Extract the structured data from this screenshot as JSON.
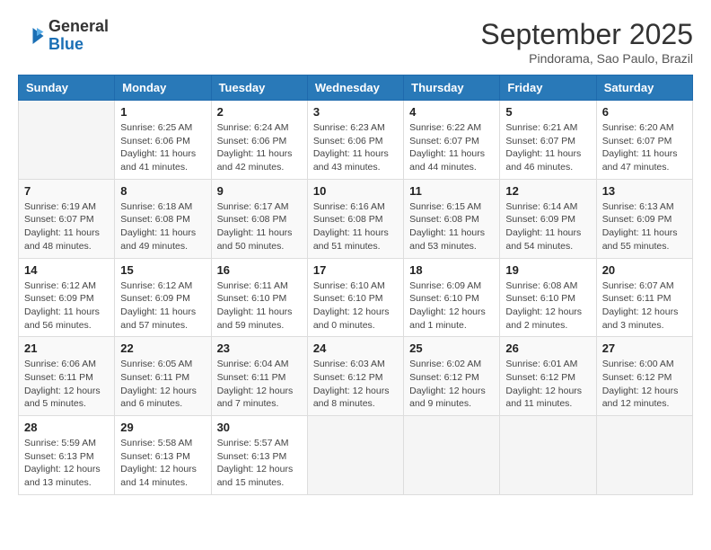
{
  "header": {
    "logo_general": "General",
    "logo_blue": "Blue",
    "month": "September 2025",
    "location": "Pindorama, Sao Paulo, Brazil"
  },
  "days_of_week": [
    "Sunday",
    "Monday",
    "Tuesday",
    "Wednesday",
    "Thursday",
    "Friday",
    "Saturday"
  ],
  "weeks": [
    [
      {
        "day": "",
        "info": ""
      },
      {
        "day": "1",
        "info": "Sunrise: 6:25 AM\nSunset: 6:06 PM\nDaylight: 11 hours\nand 41 minutes."
      },
      {
        "day": "2",
        "info": "Sunrise: 6:24 AM\nSunset: 6:06 PM\nDaylight: 11 hours\nand 42 minutes."
      },
      {
        "day": "3",
        "info": "Sunrise: 6:23 AM\nSunset: 6:06 PM\nDaylight: 11 hours\nand 43 minutes."
      },
      {
        "day": "4",
        "info": "Sunrise: 6:22 AM\nSunset: 6:07 PM\nDaylight: 11 hours\nand 44 minutes."
      },
      {
        "day": "5",
        "info": "Sunrise: 6:21 AM\nSunset: 6:07 PM\nDaylight: 11 hours\nand 46 minutes."
      },
      {
        "day": "6",
        "info": "Sunrise: 6:20 AM\nSunset: 6:07 PM\nDaylight: 11 hours\nand 47 minutes."
      }
    ],
    [
      {
        "day": "7",
        "info": "Sunrise: 6:19 AM\nSunset: 6:07 PM\nDaylight: 11 hours\nand 48 minutes."
      },
      {
        "day": "8",
        "info": "Sunrise: 6:18 AM\nSunset: 6:08 PM\nDaylight: 11 hours\nand 49 minutes."
      },
      {
        "day": "9",
        "info": "Sunrise: 6:17 AM\nSunset: 6:08 PM\nDaylight: 11 hours\nand 50 minutes."
      },
      {
        "day": "10",
        "info": "Sunrise: 6:16 AM\nSunset: 6:08 PM\nDaylight: 11 hours\nand 51 minutes."
      },
      {
        "day": "11",
        "info": "Sunrise: 6:15 AM\nSunset: 6:08 PM\nDaylight: 11 hours\nand 53 minutes."
      },
      {
        "day": "12",
        "info": "Sunrise: 6:14 AM\nSunset: 6:09 PM\nDaylight: 11 hours\nand 54 minutes."
      },
      {
        "day": "13",
        "info": "Sunrise: 6:13 AM\nSunset: 6:09 PM\nDaylight: 11 hours\nand 55 minutes."
      }
    ],
    [
      {
        "day": "14",
        "info": "Sunrise: 6:12 AM\nSunset: 6:09 PM\nDaylight: 11 hours\nand 56 minutes."
      },
      {
        "day": "15",
        "info": "Sunrise: 6:12 AM\nSunset: 6:09 PM\nDaylight: 11 hours\nand 57 minutes."
      },
      {
        "day": "16",
        "info": "Sunrise: 6:11 AM\nSunset: 6:10 PM\nDaylight: 11 hours\nand 59 minutes."
      },
      {
        "day": "17",
        "info": "Sunrise: 6:10 AM\nSunset: 6:10 PM\nDaylight: 12 hours\nand 0 minutes."
      },
      {
        "day": "18",
        "info": "Sunrise: 6:09 AM\nSunset: 6:10 PM\nDaylight: 12 hours\nand 1 minute."
      },
      {
        "day": "19",
        "info": "Sunrise: 6:08 AM\nSunset: 6:10 PM\nDaylight: 12 hours\nand 2 minutes."
      },
      {
        "day": "20",
        "info": "Sunrise: 6:07 AM\nSunset: 6:11 PM\nDaylight: 12 hours\nand 3 minutes."
      }
    ],
    [
      {
        "day": "21",
        "info": "Sunrise: 6:06 AM\nSunset: 6:11 PM\nDaylight: 12 hours\nand 5 minutes."
      },
      {
        "day": "22",
        "info": "Sunrise: 6:05 AM\nSunset: 6:11 PM\nDaylight: 12 hours\nand 6 minutes."
      },
      {
        "day": "23",
        "info": "Sunrise: 6:04 AM\nSunset: 6:11 PM\nDaylight: 12 hours\nand 7 minutes."
      },
      {
        "day": "24",
        "info": "Sunrise: 6:03 AM\nSunset: 6:12 PM\nDaylight: 12 hours\nand 8 minutes."
      },
      {
        "day": "25",
        "info": "Sunrise: 6:02 AM\nSunset: 6:12 PM\nDaylight: 12 hours\nand 9 minutes."
      },
      {
        "day": "26",
        "info": "Sunrise: 6:01 AM\nSunset: 6:12 PM\nDaylight: 12 hours\nand 11 minutes."
      },
      {
        "day": "27",
        "info": "Sunrise: 6:00 AM\nSunset: 6:12 PM\nDaylight: 12 hours\nand 12 minutes."
      }
    ],
    [
      {
        "day": "28",
        "info": "Sunrise: 5:59 AM\nSunset: 6:13 PM\nDaylight: 12 hours\nand 13 minutes."
      },
      {
        "day": "29",
        "info": "Sunrise: 5:58 AM\nSunset: 6:13 PM\nDaylight: 12 hours\nand 14 minutes."
      },
      {
        "day": "30",
        "info": "Sunrise: 5:57 AM\nSunset: 6:13 PM\nDaylight: 12 hours\nand 15 minutes."
      },
      {
        "day": "",
        "info": ""
      },
      {
        "day": "",
        "info": ""
      },
      {
        "day": "",
        "info": ""
      },
      {
        "day": "",
        "info": ""
      }
    ]
  ]
}
